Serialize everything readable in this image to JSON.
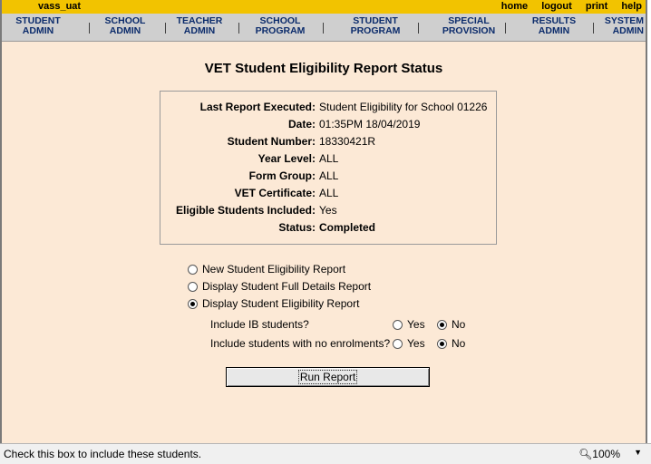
{
  "header": {
    "app_name": "vass_uat",
    "links": [
      "home",
      "logout",
      "print",
      "help"
    ]
  },
  "menu": [
    {
      "line1": "STUDENT",
      "line2": "ADMIN"
    },
    {
      "line1": "SCHOOL",
      "line2": "ADMIN"
    },
    {
      "line1": "TEACHER",
      "line2": "ADMIN"
    },
    {
      "line1": "SCHOOL",
      "line2": "PROGRAM"
    },
    {
      "line1": "STUDENT",
      "line2": "PROGRAM"
    },
    {
      "line1": "SPECIAL",
      "line2": "PROVISION"
    },
    {
      "line1": "RESULTS",
      "line2": "ADMIN"
    },
    {
      "line1": "SYSTEM",
      "line2": "ADMIN"
    }
  ],
  "page": {
    "title": "VET Student Eligibility Report Status"
  },
  "summary": [
    {
      "label": "Last Report Executed:",
      "value": "Student Eligibility for School 01226"
    },
    {
      "label": "Date:",
      "value": "01:35PM 18/04/2019"
    },
    {
      "label": "Student Number:",
      "value": "18330421R"
    },
    {
      "label": "Year Level:",
      "value": "ALL"
    },
    {
      "label": "Form Group:",
      "value": "ALL"
    },
    {
      "label": "VET Certificate:",
      "value": "ALL"
    },
    {
      "label": "Eligible Students Included:",
      "value": "Yes"
    },
    {
      "label": "Status:",
      "value": "Completed"
    }
  ],
  "options": {
    "report_types": [
      {
        "label": "New Student Eligibility Report",
        "selected": false
      },
      {
        "label": "Display Student Full Details Report",
        "selected": false
      },
      {
        "label": "Display Student Eligibility Report",
        "selected": true
      }
    ],
    "include_ib": {
      "label": "Include IB students?",
      "yes": "Yes",
      "no": "No",
      "value": "No"
    },
    "include_no_enrol": {
      "label": "Include students with no enrolments?",
      "yes": "Yes",
      "no": "No",
      "value": "No"
    }
  },
  "run_button": "Run Report",
  "statusbar": {
    "message": "Check this box to include these students.",
    "zoom": "100%"
  }
}
